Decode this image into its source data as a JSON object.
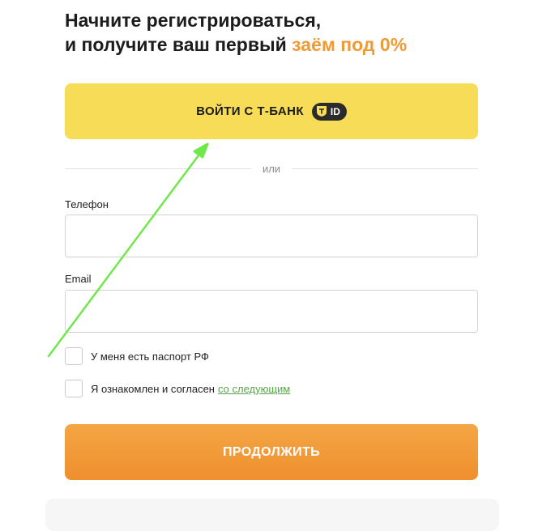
{
  "heading": {
    "line1": "Начните регистрироваться,",
    "line2_prefix": "и получите ваш первый ",
    "line2_accent": "заём под 0%"
  },
  "tbank_button": {
    "label": "ВОЙТИ С Т-БАНК",
    "badge_text": "ID"
  },
  "divider": {
    "text": "или"
  },
  "form": {
    "phone": {
      "label": "Телефон",
      "value": "",
      "placeholder": ""
    },
    "email": {
      "label": "Email",
      "value": "",
      "placeholder": ""
    },
    "passport_checkbox": {
      "label": "У меня есть паспорт РФ",
      "checked": false
    },
    "consent_checkbox": {
      "label": "Я ознакомлен и согласен",
      "link": "со следующим",
      "checked": false
    }
  },
  "continue_button": {
    "label": "ПРОДОЛЖИТЬ"
  },
  "colors": {
    "accent_orange": "#ef9a33",
    "tbank_yellow": "#f7dc58",
    "link_green": "#58a548",
    "annotation_green": "#6fe84a"
  },
  "icons": {
    "tbank_badge": "tbank-shield-icon",
    "annotation": "annotation-arrow"
  }
}
